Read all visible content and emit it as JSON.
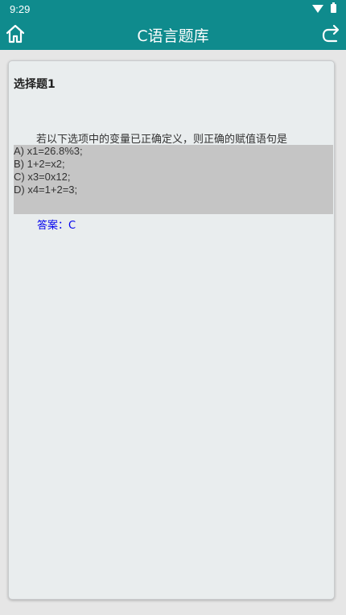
{
  "status": {
    "time": "9:29"
  },
  "toolbar": {
    "title": "C语言题库"
  },
  "question": {
    "title": "选择题1",
    "text": "若以下选项中的变量已正确定义，则正确的赋值语句是",
    "options": [
      "A) x1=26.8%3;",
      "B) 1+2=x2;",
      "C) x3=0x12;",
      "D) x4=1+2=3;"
    ],
    "answer": "答案：C"
  },
  "colors": {
    "accent": "#0f8b8d",
    "answer": "#0000ee",
    "options_bg": "#c5c5c5"
  }
}
